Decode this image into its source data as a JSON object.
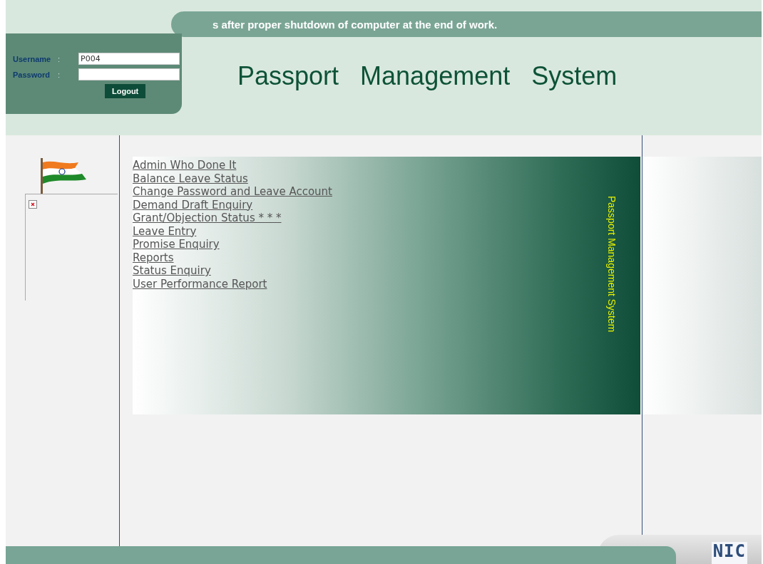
{
  "ticker": "s after proper shutdown of computer at the end of work.",
  "login": {
    "username_label": "Username",
    "username_value": "P004",
    "password_label": "Password",
    "separator": ":",
    "button": "Logout"
  },
  "title": "Passport   Management   System",
  "menu": [
    {
      "label": "Admin Who Done It"
    },
    {
      "label": "Balance Leave Status"
    },
    {
      "label": "Change Password and Leave Account"
    },
    {
      "label": "Demand Draft Enquiry"
    },
    {
      "label": "Grant/Objection Status * * *"
    },
    {
      "label": "Leave Entry"
    },
    {
      "label": "Promise Enquiry"
    },
    {
      "label": "Reports"
    },
    {
      "label": "Status Enquiry"
    },
    {
      "label": "User Performance Report"
    }
  ],
  "side_banner": "Passport Management System",
  "footer_logo": "NIC"
}
